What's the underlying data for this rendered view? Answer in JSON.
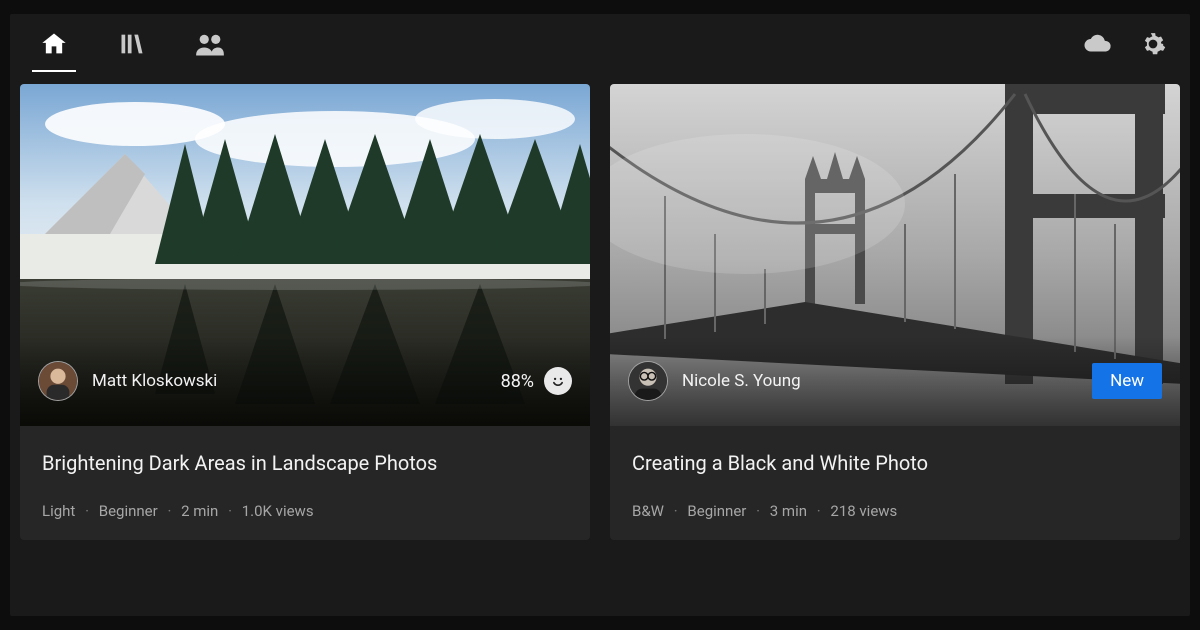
{
  "nav": {
    "left": [
      {
        "name": "home",
        "active": true
      },
      {
        "name": "library",
        "active": false
      },
      {
        "name": "people",
        "active": false
      }
    ],
    "right": [
      {
        "name": "cloud"
      },
      {
        "name": "settings"
      }
    ]
  },
  "cards": [
    {
      "author": "Matt Kloskowski",
      "rating_percent": "88%",
      "badge": null,
      "title": "Brightening Dark Areas in Landscape Photos",
      "category": "Light",
      "level": "Beginner",
      "duration": "2 min",
      "views": "1.0K views",
      "thumb_kind": "mountain"
    },
    {
      "author": "Nicole S. Young",
      "rating_percent": null,
      "badge": "New",
      "title": "Creating a Black and White Photo",
      "category": "B&W",
      "level": "Beginner",
      "duration": "3 min",
      "views": "218 views",
      "thumb_kind": "bridge"
    }
  ],
  "meta_separator": "·"
}
